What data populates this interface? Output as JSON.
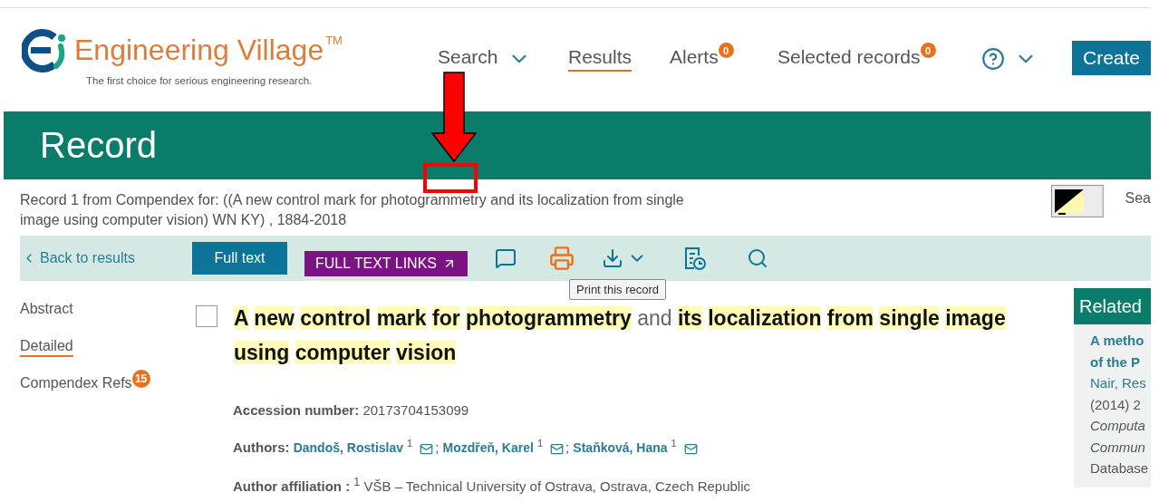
{
  "header": {
    "logo": {
      "name": "Engineering Village",
      "trademark": "TM",
      "tagline": "The first choice for serious engineering research."
    },
    "nav": [
      {
        "label": "Search",
        "kind": "dropdown",
        "selected": false
      },
      {
        "label": "Results",
        "kind": "link",
        "selected": true
      },
      {
        "label": "Alerts",
        "kind": "badge",
        "badge": "0",
        "selected": false
      },
      {
        "label": "Selected records",
        "kind": "badge",
        "badge": "0",
        "selected": false
      },
      {
        "kind": "help",
        "selected": false
      }
    ],
    "create_button": "Create"
  },
  "page_title": "Record",
  "record_info": "Record 1 from Compendex for: ((A new control mark for photogrammetry and its localization from single image using computer vision) WN KY) , 1884-2018",
  "search_link": "Sea",
  "toolbar": {
    "back": "Back to results",
    "full_text": "Full text",
    "full_text_links": "FULL TEXT LINKS",
    "tooltip": "Print this record"
  },
  "sections": [
    {
      "label": "Abstract",
      "selected": false
    },
    {
      "label": "Detailed",
      "selected": true
    },
    {
      "label": "Compendex Refs",
      "badge": "15",
      "selected": false
    }
  ],
  "record": {
    "checked": false,
    "title": [
      {
        "text": "A new control mark for photogrammetry",
        "highlighted": true
      },
      {
        "text": "and",
        "highlighted": false
      },
      {
        "text": "its localization from single image using computer vision",
        "highlighted": true
      }
    ],
    "accession": {
      "label": "Accession number:",
      "value": "20173704153099"
    },
    "authors": {
      "label": "Authors:",
      "separator": ";",
      "items": [
        {
          "name": "Dandoš, Rostislav",
          "sup": "1"
        },
        {
          "name": "Mozdřeň, Karel",
          "sup": "1"
        },
        {
          "name": "Staňková, Hana",
          "sup": "1"
        }
      ]
    },
    "affiliation": {
      "label": "Author affiliation :",
      "sup": "1",
      "value": "VŠB – Technical University of Ostrava, Ostrava, Czech Republic"
    }
  },
  "related": {
    "title": "Related",
    "lines": [
      {
        "text": "A metho",
        "kind": "link"
      },
      {
        "text": "of the P",
        "kind": "link"
      },
      {
        "text": "Nair, Res",
        "kind": "author"
      },
      {
        "text": "(2014) 2",
        "kind": "plain"
      },
      {
        "text": "Computa",
        "kind": "italic"
      },
      {
        "text": "Commun",
        "kind": "italic"
      },
      {
        "text": "Database",
        "kind": "plain"
      }
    ]
  },
  "annotations": {
    "arrow": true,
    "frame": true
  }
}
